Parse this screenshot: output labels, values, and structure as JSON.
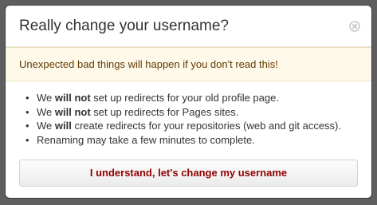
{
  "dialog": {
    "title": "Really change your username?",
    "close_icon": "close-icon",
    "warning": "Unexpected bad things will happen if you don't read this!",
    "items": [
      {
        "before": "We ",
        "bold": "will not",
        "after": " set up redirects for your old profile page."
      },
      {
        "before": "We ",
        "bold": "will not",
        "after": " set up redirects for Pages sites."
      },
      {
        "before": "We ",
        "bold": "will",
        "after": " create redirects for your repositories (web and git access)."
      },
      {
        "before": "",
        "bold": "",
        "after": "Renaming may take a few minutes to complete."
      }
    ],
    "confirm_label": "I understand, let's change my username"
  },
  "colors": {
    "overlay": "#5e5e5e",
    "warning_background": "#fff9ea",
    "warning_text": "#613a00",
    "danger_text": "#900000"
  }
}
